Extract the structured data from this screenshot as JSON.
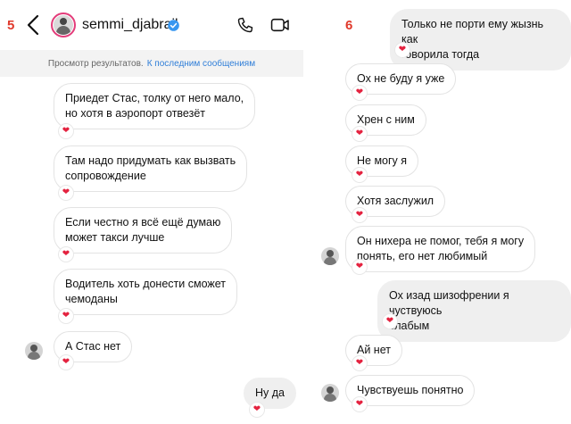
{
  "left": {
    "number": "5",
    "header": {
      "username": "semmi_djabrail"
    },
    "results_bar": {
      "text": "Просмотр результатов.",
      "link": "К последним сообщениям"
    },
    "messages": [
      {
        "text": "Приедет Стас, толку от него мало,\nно хотя в аэропорт отвезёт",
        "reaction": "❤"
      },
      {
        "text": "Там надо придумать как вызвать\nсопровождение",
        "reaction": "❤"
      },
      {
        "text": "Если честно я всё ещё думаю\nможет такси лучше",
        "reaction": "❤"
      },
      {
        "text": "Водитель хоть донести сможет\nчемоданы",
        "reaction": "❤"
      },
      {
        "text": "А Стас нет",
        "reaction": "❤"
      },
      {
        "text": "Ну да",
        "reaction": "❤"
      }
    ]
  },
  "right": {
    "number": "6",
    "messages": [
      {
        "text": "Только не порти ему жызнь как\nговорила тогда",
        "reaction": "❤"
      },
      {
        "text": "Ох не буду я уже",
        "reaction": "❤"
      },
      {
        "text": "Хрен с ним",
        "reaction": "❤"
      },
      {
        "text": "Не могу я",
        "reaction": "❤"
      },
      {
        "text": "Хотя заслужил",
        "reaction": "❤"
      },
      {
        "text": "Он нихера не помог, тебя я могу\nпонять, его нет любимый",
        "reaction": "❤"
      },
      {
        "text": "Ох изад шизофрении я чуствуюсь\nслабым",
        "reaction": "❤"
      },
      {
        "text": "Ай нет",
        "reaction": "❤"
      },
      {
        "text": "Чувствуешь понятно",
        "reaction": "❤"
      }
    ]
  }
}
